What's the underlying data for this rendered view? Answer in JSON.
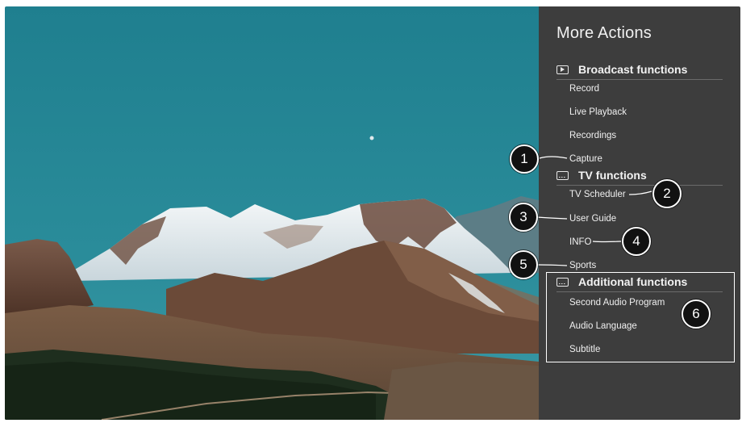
{
  "panel": {
    "title": "More Actions",
    "sections": [
      {
        "icon": "broadcast-icon",
        "label": "Broadcast functions",
        "items": [
          "Record",
          "Live Playback",
          "Recordings",
          "Capture"
        ]
      },
      {
        "icon": "tv-icon",
        "label": "TV functions",
        "items": [
          "TV Scheduler",
          "User Guide",
          "INFO",
          "Sports"
        ]
      },
      {
        "icon": "additional-icon",
        "label": "Additional functions",
        "items": [
          "Second Audio Program",
          "Audio Language",
          "Subtitle"
        ]
      }
    ]
  },
  "callouts": [
    "1",
    "2",
    "3",
    "4",
    "5",
    "6"
  ],
  "colors": {
    "panel_bg": "#3d3d3d",
    "callout_bg": "#111111",
    "highlight": "#ffffff"
  }
}
